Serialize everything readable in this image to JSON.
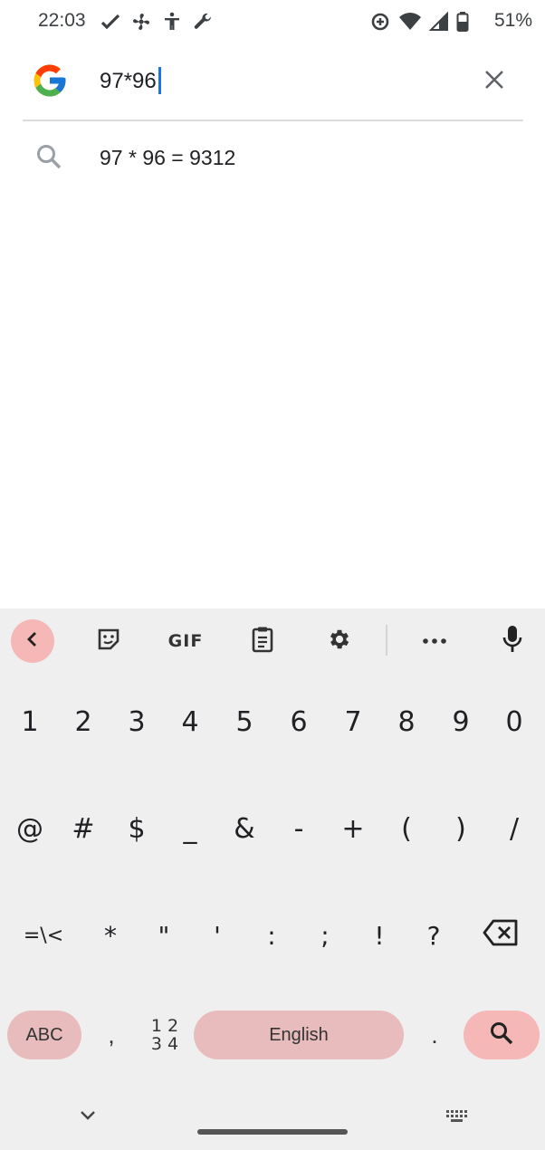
{
  "status_bar": {
    "time": "22:03",
    "battery": "51%",
    "left_icons": [
      "check-icon",
      "fan-icon",
      "accessibility-icon",
      "wrench-icon"
    ],
    "right_icons": [
      "data-saver-icon",
      "wifi-icon",
      "signal-icon",
      "battery-icon"
    ]
  },
  "search": {
    "query": "97*96",
    "logo": "google-g-logo",
    "clear_icon": "close-icon"
  },
  "suggestions": [
    {
      "icon": "search-icon",
      "text": "97 * 96 = 9312"
    }
  ],
  "keyboard": {
    "toolbar": {
      "items": [
        "back-icon",
        "sticker-icon",
        "GIF",
        "clipboard-icon",
        "gear-icon",
        "more-icon",
        "mic-icon"
      ],
      "gif_label": "GIF"
    },
    "rows": {
      "row1": [
        "1",
        "2",
        "3",
        "4",
        "5",
        "6",
        "7",
        "8",
        "9",
        "0"
      ],
      "row2": [
        "@",
        "#",
        "$",
        "_",
        "&",
        "-",
        "+",
        "(",
        ")",
        "/"
      ],
      "row3": [
        "=\\<",
        "*",
        "\"",
        "'",
        ":",
        ";",
        "!",
        "?"
      ]
    },
    "bottom": {
      "abc_label": "ABC",
      "comma": ",",
      "numpad_top": "1 2",
      "numpad_bottom": "3 4",
      "space_label": "English",
      "period": ".",
      "action_icon": "search-icon"
    }
  },
  "colors": {
    "accent": "#1a73e8",
    "key_pill": "#e8bcbc",
    "action_pill": "#f6b7b7",
    "keyboard_bg": "#f0efef"
  }
}
